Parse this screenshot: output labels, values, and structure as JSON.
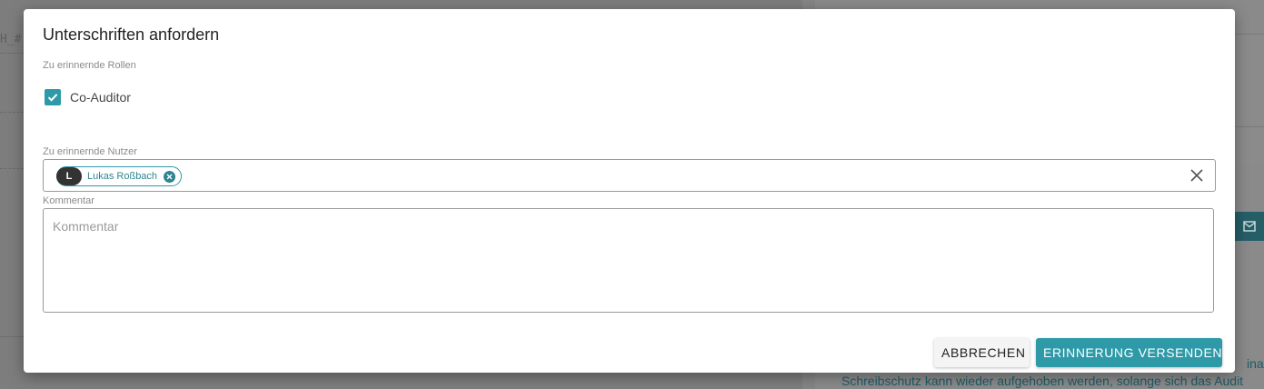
{
  "background": {
    "left_fragment": "H_#",
    "right_text_line1": "inale",
    "right_text_line2": "Schreibschutz kann wieder aufgehoben werden, solange sich das Audit"
  },
  "dialog": {
    "title": "Unterschriften anfordern",
    "roles": {
      "label": "Zu erinnernde Rollen",
      "items": [
        {
          "label": "Co-Auditor",
          "checked": true
        }
      ]
    },
    "users": {
      "label": "Zu erinnernde Nutzer",
      "chips": [
        {
          "initial": "L",
          "name": "Lukas Roßbach"
        }
      ]
    },
    "comment": {
      "label": "Kommentar",
      "placeholder": "Kommentar",
      "value": ""
    },
    "buttons": {
      "cancel": "ABBRECHEN",
      "send": "ERINNERUNG VERSENDEN"
    }
  },
  "colors": {
    "accent": "#2e9aa8",
    "overlay": "#7d7d7d"
  },
  "icons": {
    "checkbox": "check-icon",
    "chip_remove": "close-circle-icon",
    "clear": "close-icon",
    "mail": "mail-icon"
  }
}
